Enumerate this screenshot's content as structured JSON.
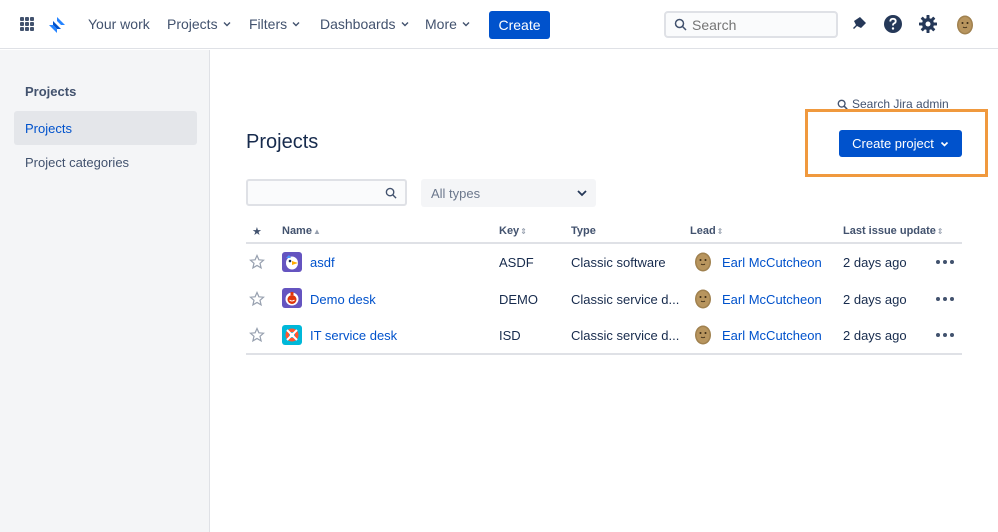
{
  "topnav": {
    "items": [
      {
        "label": "Your work",
        "dropdown": false
      },
      {
        "label": "Projects",
        "dropdown": true
      },
      {
        "label": "Filters",
        "dropdown": true
      },
      {
        "label": "Dashboards",
        "dropdown": true
      },
      {
        "label": "More",
        "dropdown": true
      }
    ],
    "create_label": "Create",
    "search_placeholder": "Search",
    "icons": [
      "app-switcher-icon",
      "jira-logo-icon",
      "notifications-icon",
      "help-icon",
      "settings-icon",
      "avatar"
    ]
  },
  "sidebar": {
    "heading": "Projects",
    "items": [
      {
        "label": "Projects",
        "active": true
      },
      {
        "label": "Project categories",
        "active": false
      }
    ]
  },
  "main": {
    "admin_search": "Search Jira admin",
    "title": "Projects",
    "create_project_label": "Create project",
    "filter_placeholder": "",
    "type_select": "All types",
    "columns": {
      "star": "★",
      "name": "Name",
      "key": "Key",
      "type": "Type",
      "lead": "Lead",
      "last_update": "Last issue update"
    },
    "rows": [
      {
        "name": "asdf",
        "key": "ASDF",
        "type": "Classic software",
        "lead": "Earl McCutcheon",
        "last_update": "2 days ago",
        "icon": "asdf-project-icon"
      },
      {
        "name": "Demo desk",
        "key": "DEMO",
        "type": "Classic service d...",
        "lead": "Earl McCutcheon",
        "last_update": "2 days ago",
        "icon": "demo-desk-project-icon"
      },
      {
        "name": "IT service desk",
        "key": "ISD",
        "type": "Classic service d...",
        "lead": "Earl McCutcheon",
        "last_update": "2 days ago",
        "icon": "it-service-desk-project-icon"
      }
    ]
  },
  "colors": {
    "brand": "#0052cc",
    "highlight": "#f0993e",
    "sidebar_bg": "#f4f5f7"
  }
}
